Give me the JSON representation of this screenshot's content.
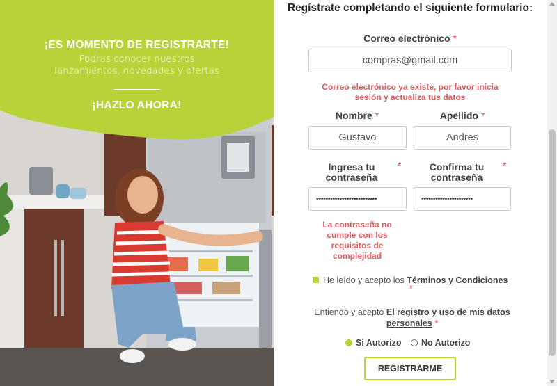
{
  "promo": {
    "headline": "¡ES MOMENTO DE REGISTRARTE!",
    "subline_1": "Podras conocer nuestros",
    "subline_2": "lanzamientos, novedades y ofertas",
    "cta": "¡HAZLO AHORA!",
    "accent_color": "#b8d33a"
  },
  "form": {
    "title": "Regístrate completando el siguiente formulario:",
    "required_mark": "*",
    "email": {
      "label": "Correo electrónico",
      "value": "compras@gmail.com",
      "error": "Correo electrónico ya existe, por favor inicia sesión y actualiza tus datos"
    },
    "first_name": {
      "label": "Nombre",
      "value": "Gustavo"
    },
    "last_name": {
      "label": "Apellido",
      "value": "Andres"
    },
    "password": {
      "label_1": "Ingresa tu",
      "label_2": "contraseña",
      "value": "••••••••••••••••••••••••••",
      "error_1": "La contraseña no",
      "error_2": "cumple con los",
      "error_3": "requisitos de",
      "error_4": "complejidad"
    },
    "confirm_password": {
      "label_1": "Confirma tu",
      "label_2": "contraseña",
      "value": "••••••••••••••••••••••"
    },
    "terms": {
      "text": "He leído y acepto los",
      "link": "Términos y Condiciones",
      "checked": true
    },
    "consent": {
      "text": "Entiendo y acepto",
      "link": "El registro y uso de mis datos personales"
    },
    "authorization": {
      "options": [
        "Si Autorizo",
        "No Autorizo"
      ],
      "selected": "Si Autorizo"
    },
    "submit_label": "REGISTRARME",
    "error_color": "#e25b5e"
  }
}
